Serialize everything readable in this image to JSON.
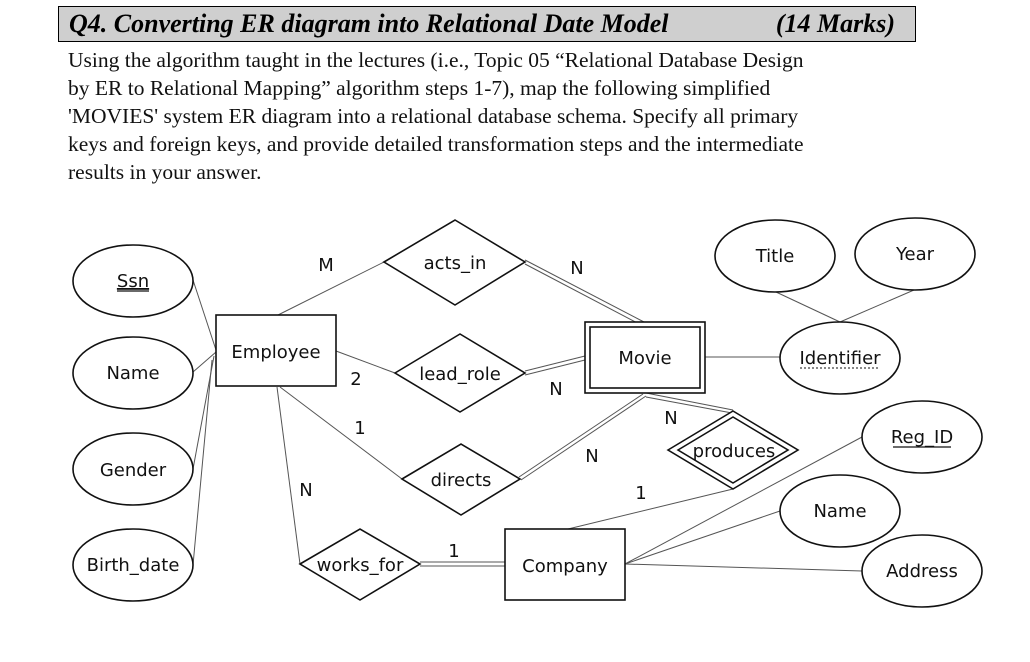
{
  "question": {
    "title": "Q4. Converting ER diagram into Relational Date Model",
    "marks": "(14 Marks)",
    "paragraph_lines": [
      "Using the algorithm taught in the lectures (i.e., Topic 05 “Relational Database Design",
      "by ER to Relational Mapping” algorithm steps 1-7), map the following simplified",
      "'MOVIES' system ER diagram into a relational database schema. Specify all primary",
      "keys and foreign keys, and provide detailed transformation steps and the intermediate",
      "results in your answer."
    ]
  },
  "er_diagram": {
    "entities": [
      {
        "name": "Employee",
        "type": "strong"
      },
      {
        "name": "Movie",
        "type": "weak"
      },
      {
        "name": "Company",
        "type": "strong"
      }
    ],
    "relationships": [
      {
        "name": "acts_in",
        "identifying": false,
        "between": [
          "Employee",
          "Movie"
        ],
        "cardinality": [
          "M",
          "N"
        ]
      },
      {
        "name": "lead_role",
        "identifying": false,
        "between": [
          "Employee",
          "Movie"
        ],
        "cardinality": [
          "2",
          "N"
        ]
      },
      {
        "name": "directs",
        "identifying": false,
        "between": [
          "Employee",
          "Movie"
        ],
        "cardinality": [
          "1",
          "N"
        ]
      },
      {
        "name": "produces",
        "identifying": true,
        "between": [
          "Company",
          "Movie"
        ],
        "cardinality": [
          "1",
          "N"
        ]
      },
      {
        "name": "works_for",
        "identifying": false,
        "between": [
          "Employee",
          "Company"
        ],
        "cardinality": [
          "N",
          "1"
        ]
      }
    ],
    "attributes": {
      "employee_ssn": "Ssn",
      "employee_name": "Name",
      "employee_gender": "Gender",
      "employee_birth_date": "Birth_date",
      "movie_identifier": "Identifier",
      "identifier_title": "Title",
      "identifier_year": "Year",
      "company_reg_id": "Reg_ID",
      "company_name": "Name",
      "company_address": "Address"
    },
    "labels": {
      "acts_in_employee": "M",
      "acts_in_movie": "N",
      "lead_role_employee": "2",
      "lead_role_movie": "N",
      "directs_employee": "1",
      "directs_movie": "N",
      "produces_movie": "N",
      "produces_company": "1",
      "works_for_employee": "N",
      "works_for_company": "1"
    }
  }
}
